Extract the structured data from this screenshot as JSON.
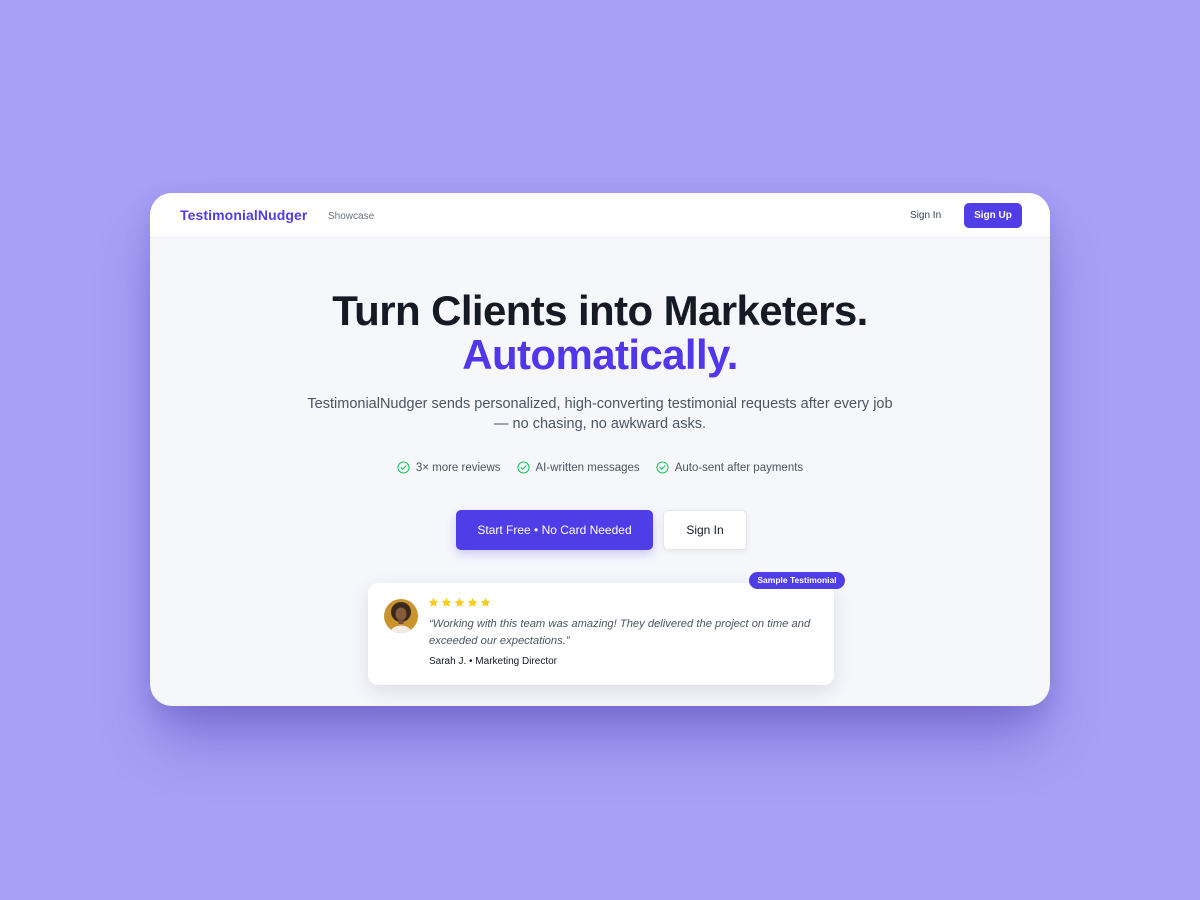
{
  "nav": {
    "brand": "TestimonialNudger",
    "links": [
      "Showcase"
    ],
    "signin": "Sign In",
    "signup": "Sign Up"
  },
  "hero": {
    "title_line1": "Turn Clients into Marketers.",
    "title_line2": "Automatically.",
    "subtitle": "TestimonialNudger sends personalized, high-converting testimonial requests after every job — no chasing, no awkward asks.",
    "features": [
      {
        "label": "3× more reviews",
        "icon": "check-circle-icon"
      },
      {
        "label": "AI-written messages",
        "icon": "check-circle-icon"
      },
      {
        "label": "Auto-sent after payments",
        "icon": "check-circle-icon"
      }
    ],
    "cta_primary": "Start Free • No Card Needed",
    "cta_secondary": "Sign In"
  },
  "testimonial": {
    "badge": "Sample Testimonial",
    "rating": 5,
    "quote": "“Working with this team was amazing! They delivered the project on time and exceeded our expectations.”",
    "author": "Sarah J. • Marketing Director"
  },
  "colors": {
    "backdrop": "#a7a0f7",
    "accent": "#4f3ee8",
    "heading": "#151a25",
    "check": "#22c55e",
    "star": "#facc15"
  }
}
